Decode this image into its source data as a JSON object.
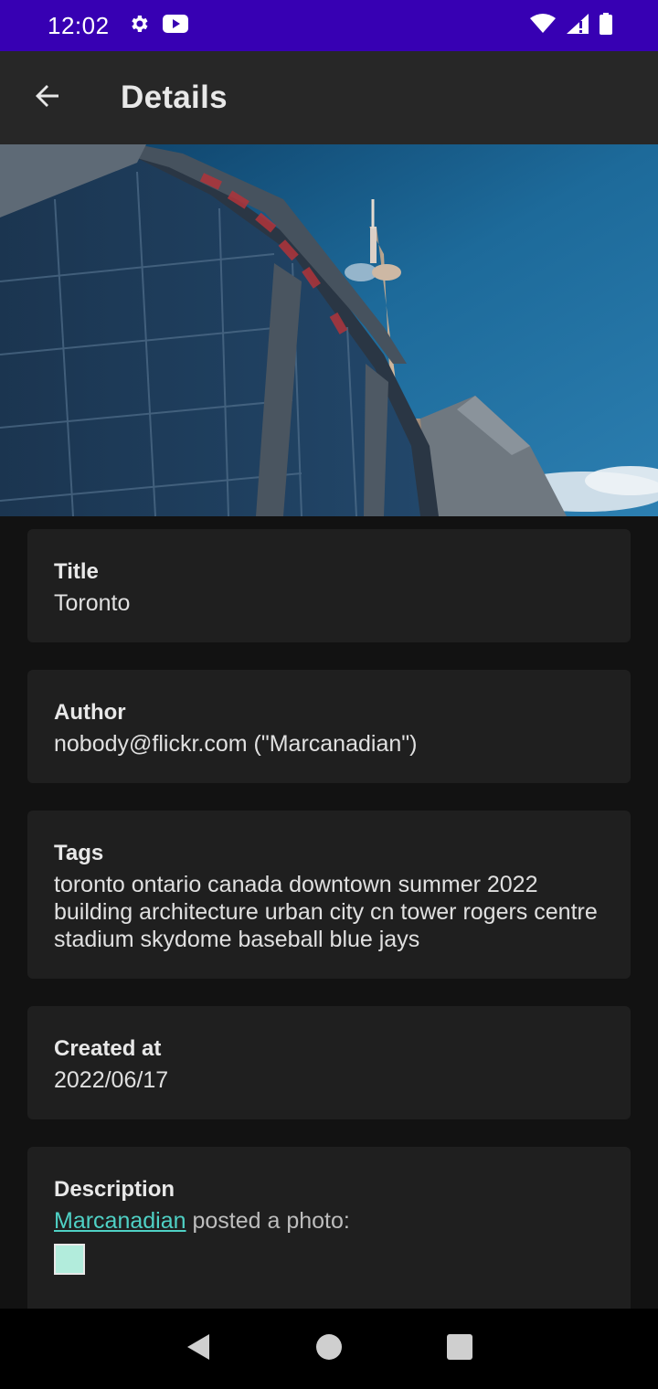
{
  "status_bar": {
    "time": "12:02",
    "left_icons": [
      "gear-icon",
      "youtube-icon"
    ],
    "right_icons": [
      "wifi-icon",
      "cell-signal-icon",
      "battery-icon"
    ],
    "background": "#3700b3"
  },
  "app_bar": {
    "title": "Details",
    "back_icon": "arrow-left-icon"
  },
  "hero_image": {
    "subject": "rogers-centre-and-cn-tower-photo"
  },
  "fields": [
    {
      "label": "Title",
      "value": "Toronto"
    },
    {
      "label": "Author",
      "value": "nobody@flickr.com (\"Marcanadian\")"
    },
    {
      "label": "Tags",
      "value": "toronto ontario canada downtown summer 2022 building architecture urban city cn tower rogers centre stadium skydome baseball blue jays"
    },
    {
      "label": "Created at",
      "value": "2022/06/17"
    }
  ],
  "description": {
    "label": "Description",
    "link_text": "Marcanadian",
    "text": " posted a photo:",
    "link_color": "#4fd1c5"
  },
  "nav_bar": {
    "buttons": [
      "back-triangle-icon",
      "home-circle-icon",
      "recents-square-icon"
    ]
  }
}
